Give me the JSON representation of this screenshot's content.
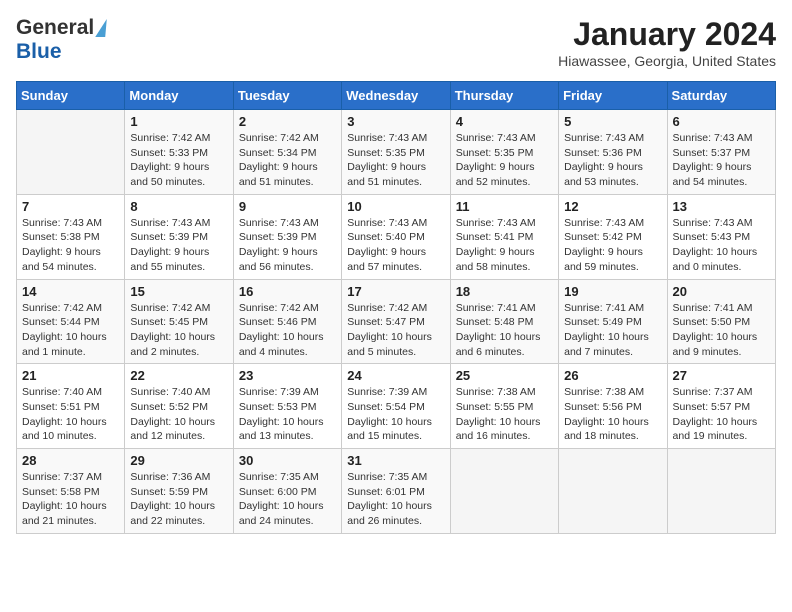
{
  "header": {
    "logo_general": "General",
    "logo_blue": "Blue",
    "title": "January 2024",
    "subtitle": "Hiawassee, Georgia, United States"
  },
  "weekdays": [
    "Sunday",
    "Monday",
    "Tuesday",
    "Wednesday",
    "Thursday",
    "Friday",
    "Saturday"
  ],
  "weeks": [
    [
      {
        "day": "",
        "info": ""
      },
      {
        "day": "1",
        "info": "Sunrise: 7:42 AM\nSunset: 5:33 PM\nDaylight: 9 hours\nand 50 minutes."
      },
      {
        "day": "2",
        "info": "Sunrise: 7:42 AM\nSunset: 5:34 PM\nDaylight: 9 hours\nand 51 minutes."
      },
      {
        "day": "3",
        "info": "Sunrise: 7:43 AM\nSunset: 5:35 PM\nDaylight: 9 hours\nand 51 minutes."
      },
      {
        "day": "4",
        "info": "Sunrise: 7:43 AM\nSunset: 5:35 PM\nDaylight: 9 hours\nand 52 minutes."
      },
      {
        "day": "5",
        "info": "Sunrise: 7:43 AM\nSunset: 5:36 PM\nDaylight: 9 hours\nand 53 minutes."
      },
      {
        "day": "6",
        "info": "Sunrise: 7:43 AM\nSunset: 5:37 PM\nDaylight: 9 hours\nand 54 minutes."
      }
    ],
    [
      {
        "day": "7",
        "info": "Sunrise: 7:43 AM\nSunset: 5:38 PM\nDaylight: 9 hours\nand 54 minutes."
      },
      {
        "day": "8",
        "info": "Sunrise: 7:43 AM\nSunset: 5:39 PM\nDaylight: 9 hours\nand 55 minutes."
      },
      {
        "day": "9",
        "info": "Sunrise: 7:43 AM\nSunset: 5:39 PM\nDaylight: 9 hours\nand 56 minutes."
      },
      {
        "day": "10",
        "info": "Sunrise: 7:43 AM\nSunset: 5:40 PM\nDaylight: 9 hours\nand 57 minutes."
      },
      {
        "day": "11",
        "info": "Sunrise: 7:43 AM\nSunset: 5:41 PM\nDaylight: 9 hours\nand 58 minutes."
      },
      {
        "day": "12",
        "info": "Sunrise: 7:43 AM\nSunset: 5:42 PM\nDaylight: 9 hours\nand 59 minutes."
      },
      {
        "day": "13",
        "info": "Sunrise: 7:43 AM\nSunset: 5:43 PM\nDaylight: 10 hours\nand 0 minutes."
      }
    ],
    [
      {
        "day": "14",
        "info": "Sunrise: 7:42 AM\nSunset: 5:44 PM\nDaylight: 10 hours\nand 1 minute."
      },
      {
        "day": "15",
        "info": "Sunrise: 7:42 AM\nSunset: 5:45 PM\nDaylight: 10 hours\nand 2 minutes."
      },
      {
        "day": "16",
        "info": "Sunrise: 7:42 AM\nSunset: 5:46 PM\nDaylight: 10 hours\nand 4 minutes."
      },
      {
        "day": "17",
        "info": "Sunrise: 7:42 AM\nSunset: 5:47 PM\nDaylight: 10 hours\nand 5 minutes."
      },
      {
        "day": "18",
        "info": "Sunrise: 7:41 AM\nSunset: 5:48 PM\nDaylight: 10 hours\nand 6 minutes."
      },
      {
        "day": "19",
        "info": "Sunrise: 7:41 AM\nSunset: 5:49 PM\nDaylight: 10 hours\nand 7 minutes."
      },
      {
        "day": "20",
        "info": "Sunrise: 7:41 AM\nSunset: 5:50 PM\nDaylight: 10 hours\nand 9 minutes."
      }
    ],
    [
      {
        "day": "21",
        "info": "Sunrise: 7:40 AM\nSunset: 5:51 PM\nDaylight: 10 hours\nand 10 minutes."
      },
      {
        "day": "22",
        "info": "Sunrise: 7:40 AM\nSunset: 5:52 PM\nDaylight: 10 hours\nand 12 minutes."
      },
      {
        "day": "23",
        "info": "Sunrise: 7:39 AM\nSunset: 5:53 PM\nDaylight: 10 hours\nand 13 minutes."
      },
      {
        "day": "24",
        "info": "Sunrise: 7:39 AM\nSunset: 5:54 PM\nDaylight: 10 hours\nand 15 minutes."
      },
      {
        "day": "25",
        "info": "Sunrise: 7:38 AM\nSunset: 5:55 PM\nDaylight: 10 hours\nand 16 minutes."
      },
      {
        "day": "26",
        "info": "Sunrise: 7:38 AM\nSunset: 5:56 PM\nDaylight: 10 hours\nand 18 minutes."
      },
      {
        "day": "27",
        "info": "Sunrise: 7:37 AM\nSunset: 5:57 PM\nDaylight: 10 hours\nand 19 minutes."
      }
    ],
    [
      {
        "day": "28",
        "info": "Sunrise: 7:37 AM\nSunset: 5:58 PM\nDaylight: 10 hours\nand 21 minutes."
      },
      {
        "day": "29",
        "info": "Sunrise: 7:36 AM\nSunset: 5:59 PM\nDaylight: 10 hours\nand 22 minutes."
      },
      {
        "day": "30",
        "info": "Sunrise: 7:35 AM\nSunset: 6:00 PM\nDaylight: 10 hours\nand 24 minutes."
      },
      {
        "day": "31",
        "info": "Sunrise: 7:35 AM\nSunset: 6:01 PM\nDaylight: 10 hours\nand 26 minutes."
      },
      {
        "day": "",
        "info": ""
      },
      {
        "day": "",
        "info": ""
      },
      {
        "day": "",
        "info": ""
      }
    ]
  ]
}
